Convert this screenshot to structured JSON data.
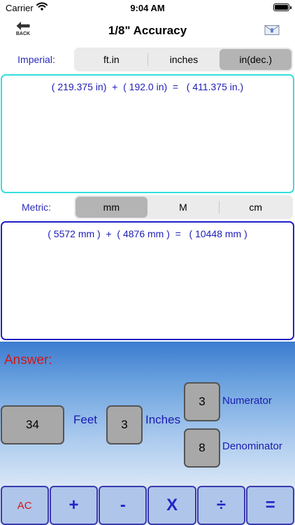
{
  "status_bar": {
    "carrier": "Carrier",
    "time": "9:04 AM",
    "icons": [
      "wifi-icon",
      "battery-icon"
    ]
  },
  "nav": {
    "back_label": "BACK",
    "title": "1/8\" Accuracy",
    "icons": [
      "back-arrow-icon",
      "mail-icon"
    ]
  },
  "imperial": {
    "label": "Imperial:",
    "options": [
      "ft.in",
      "inches",
      "in(dec.)"
    ],
    "selected": "in(dec.)",
    "expression": "( 219.375 in)  +  ( 192.0 in)  =   ( 411.375 in.)"
  },
  "metric": {
    "label": "Metric:",
    "options": [
      "mm",
      "M",
      "cm"
    ],
    "selected": "mm",
    "expression": "( 5572 mm )  +  ( 4876 mm )  =   ( 10448 mm )"
  },
  "answer": {
    "label": "Answer:",
    "feet_value": "34",
    "feet_label": "Feet",
    "inches_value": "3",
    "inches_label": "Inches",
    "numerator_value": "3",
    "numerator_label": "Numerator",
    "denominator_value": "8",
    "denominator_label": "Denominator"
  },
  "keypad": {
    "keys": [
      "AC",
      "+",
      "-",
      "X",
      "÷",
      "="
    ]
  },
  "colors": {
    "label_blue": "#2b2bbd",
    "answer_red": "#d01818",
    "imperial_border": "#35dede",
    "metric_border": "#2020c8",
    "key_blue": "#2323c8"
  }
}
